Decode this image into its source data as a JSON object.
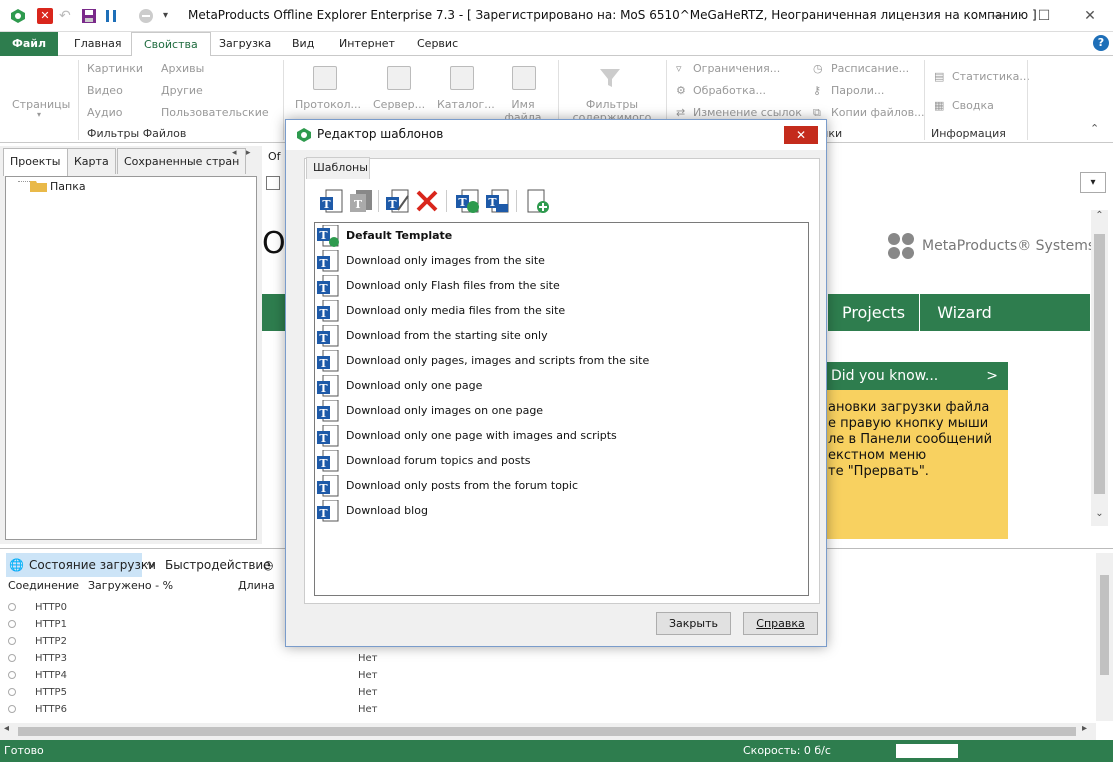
{
  "titlebar": {
    "title": "MetaProducts Offline Explorer Enterprise 7.3 - [ Зарегистрировано на: MoS 6510^MeGaHeRTZ, Неограниченная лицензия на компанию ]"
  },
  "menu": {
    "file": "Файл",
    "tabs": [
      "Главная",
      "Свойства",
      "Загрузка",
      "Вид",
      "Интернет",
      "Сервис"
    ]
  },
  "ribbon": {
    "pages": "Страницы",
    "filters": {
      "col1": [
        "Картинки",
        "Видео",
        "Аудио"
      ],
      "col2": [
        "Архивы",
        "Другие",
        "Пользовательские"
      ],
      "group_label": "Фильтры Файлов"
    },
    "buttons": [
      "Протокол...",
      "Сервер...",
      "Каталог...",
      "Имя файла",
      "Фильтры содержимого"
    ],
    "col3": [
      "Ограничения...",
      "Обработка...",
      "Изменение ссылок"
    ],
    "col4": [
      "Расписание...",
      "Пароли...",
      "Копии файлов..."
    ],
    "settings_label": "Настройки",
    "info": [
      "Статистика...",
      "Сводка"
    ],
    "info_label": "Информация"
  },
  "left_panel": {
    "tabs": [
      "Проекты",
      "Карта",
      "Сохраненные стран"
    ],
    "tree": [
      {
        "label": "Папка"
      }
    ]
  },
  "right_content": {
    "tab_label": "Of",
    "big_letter": "O",
    "brand": "MetaProducts® Systems",
    "nav": [
      "Projects",
      "Wizard"
    ],
    "dyk_title": "Did you know...",
    "dyk_arrow": ">",
    "dyk_lines": [
      "ановки загрузки файла",
      "е правую кнопку мыши",
      "ле в Панели сообщений",
      "екстном меню",
      "те \"Прервать\"."
    ]
  },
  "bottom_panel": {
    "tabs": [
      "Состояние загрузки",
      "Быстродействие"
    ],
    "columns": [
      "Соединение",
      "Загружено - %",
      "Длина"
    ],
    "rows": [
      {
        "conn": "HTTP0",
        "status": ""
      },
      {
        "conn": "HTTP1",
        "status": ""
      },
      {
        "conn": "HTTP2",
        "status": ""
      },
      {
        "conn": "HTTP3",
        "status": "Нет"
      },
      {
        "conn": "HTTP4",
        "status": "Нет"
      },
      {
        "conn": "HTTP5",
        "status": "Нет"
      },
      {
        "conn": "HTTP6",
        "status": "Нет"
      }
    ]
  },
  "statusbar": {
    "left": "Готово",
    "speed": "Скорость: 0 б/с"
  },
  "dialog": {
    "title": "Редактор шаблонов",
    "close": "✕",
    "tab": "Шаблоны",
    "templates": [
      "Default Template",
      "Download only images from the site",
      "Download only Flash files from the site",
      "Download only media files from the site",
      "Download from the starting site only",
      "Download only pages, images and scripts from the site",
      "Download only one page",
      "Download only images on one page",
      "Download only one page with images and scripts",
      "Download forum topics and posts",
      "Download only posts from the forum topic",
      "Download blog"
    ],
    "close_button": "Закрыть",
    "help_button": "Справка"
  },
  "colors": {
    "accent": "#2e7d4e",
    "yellow": "#f8d160",
    "close_red": "#c42b1c"
  }
}
